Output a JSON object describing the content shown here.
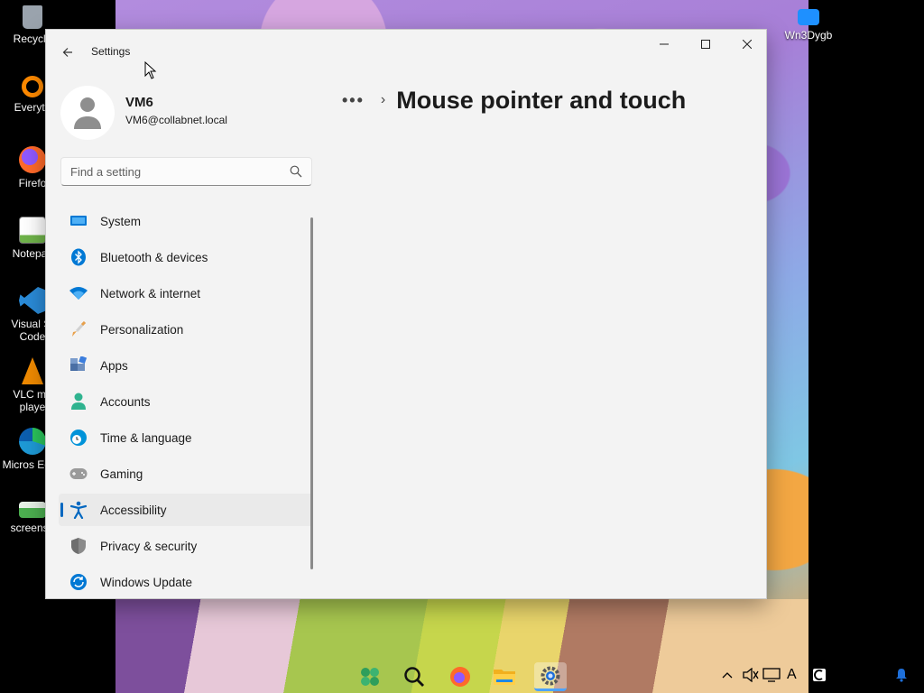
{
  "desktop": {
    "icons": [
      {
        "label": "Recycle",
        "color": "#9aa3ad"
      },
      {
        "label": "Everyth",
        "color": "#ff8a00"
      },
      {
        "label": "Firefo",
        "color": "#ff6a2a"
      },
      {
        "label": "Notepac",
        "color": "#6fb34a"
      },
      {
        "label": "Visual St Code",
        "color": "#2a8bd8"
      },
      {
        "label": "VLC me playe",
        "color": "#f08a00"
      },
      {
        "label": "Micros Edge",
        "color": "#1e9ad6"
      },
      {
        "label": "screensh",
        "color": "#4caf50"
      }
    ],
    "top_right_icon": {
      "label": "Wn3Dygb",
      "color": "#1e90ff"
    }
  },
  "window": {
    "app_title": "Settings",
    "back_icon": "back-arrow-icon",
    "controls": {
      "minimize": "minimize-icon",
      "maximize": "maximize-icon",
      "close": "close-icon"
    },
    "profile": {
      "name": "VM6",
      "email": "VM6@collabnet.local"
    },
    "search": {
      "placeholder": "Find a setting",
      "value": ""
    },
    "nav": [
      {
        "label": "System",
        "icon": "system-icon",
        "color": "#0078d4"
      },
      {
        "label": "Bluetooth & devices",
        "icon": "bluetooth-icon",
        "color": "#0078d4"
      },
      {
        "label": "Network & internet",
        "icon": "wifi-icon",
        "color": "#0078d4"
      },
      {
        "label": "Personalization",
        "icon": "brush-icon",
        "color": "#e8a04a"
      },
      {
        "label": "Apps",
        "icon": "apps-icon",
        "color": "#4a6fa5"
      },
      {
        "label": "Accounts",
        "icon": "accounts-icon",
        "color": "#2fb38f"
      },
      {
        "label": "Time & language",
        "icon": "globe-clock-icon",
        "color": "#0093d9"
      },
      {
        "label": "Gaming",
        "icon": "gamepad-icon",
        "color": "#8a8a8a"
      },
      {
        "label": "Accessibility",
        "icon": "accessibility-icon",
        "color": "#0067c0"
      },
      {
        "label": "Privacy & security",
        "icon": "shield-icon",
        "color": "#7a7a7a"
      },
      {
        "label": "Windows Update",
        "icon": "update-icon",
        "color": "#0078d4"
      }
    ],
    "selected_nav": "Accessibility",
    "breadcrumb": {
      "more": "•••",
      "separator": "›",
      "title": "Mouse pointer and touch"
    }
  },
  "taskbar": {
    "items": [
      "start-icon",
      "search-icon",
      "firefox-icon",
      "file-explorer-icon",
      "settings-icon"
    ],
    "active": "settings-icon",
    "tray": [
      "chevron-up-icon",
      "volume-icon",
      "display-icon",
      "language-icon",
      "app-tray-icon",
      "notification-icon"
    ],
    "tray_language": "A"
  }
}
